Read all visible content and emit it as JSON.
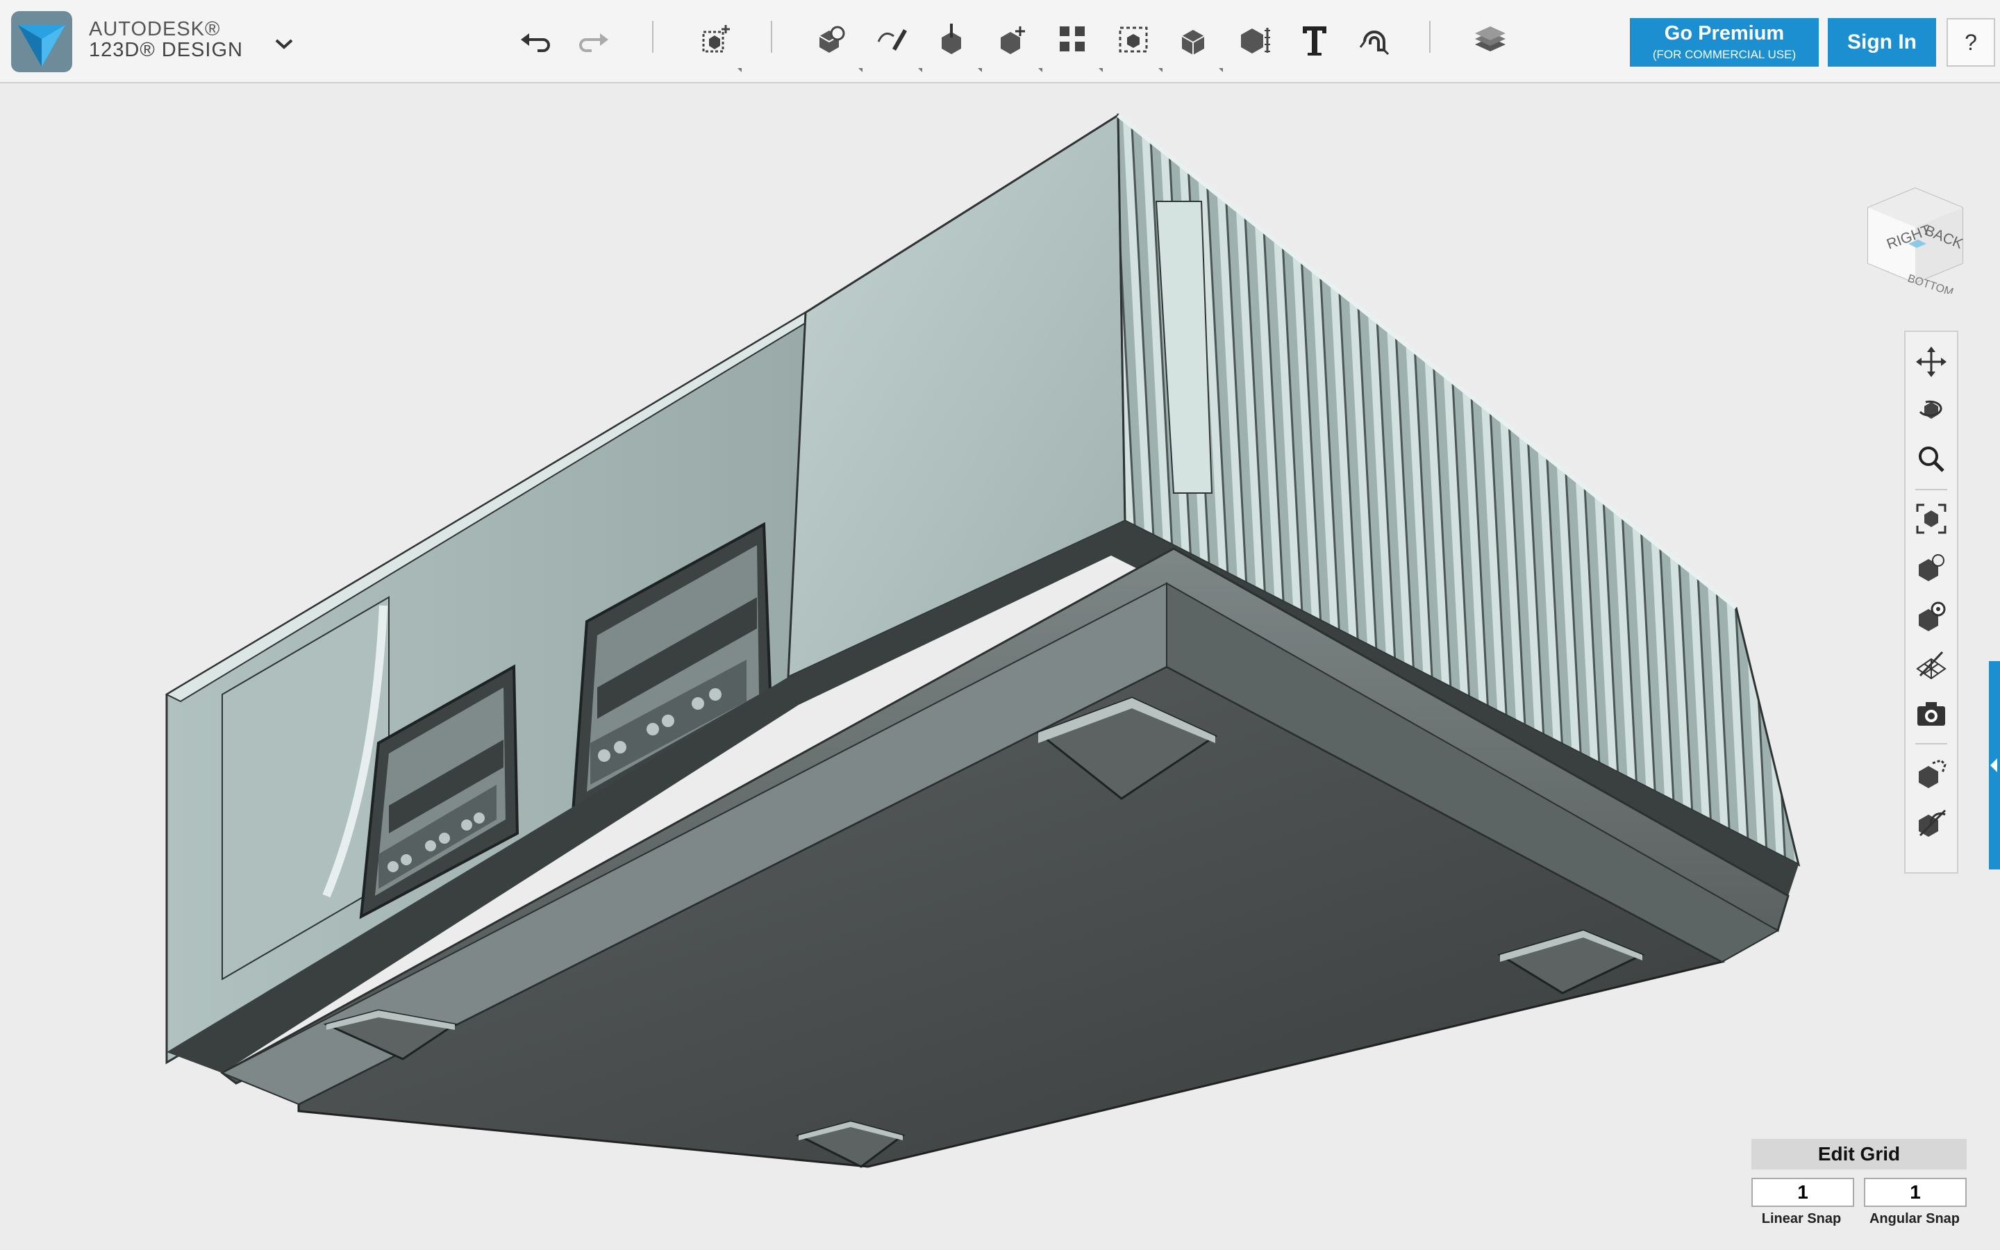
{
  "app": {
    "brand_top": "AUTODESK®",
    "brand_bottom": "123D® DESIGN"
  },
  "toolbar": {
    "tools": [
      {
        "name": "undo-icon"
      },
      {
        "name": "redo-icon"
      },
      {
        "name": "transform-icon"
      },
      {
        "name": "primitives-icon"
      },
      {
        "name": "sketch-icon"
      },
      {
        "name": "construct-icon"
      },
      {
        "name": "modify-icon"
      },
      {
        "name": "pattern-icon"
      },
      {
        "name": "grouping-icon"
      },
      {
        "name": "combine-icon"
      },
      {
        "name": "measure-icon"
      },
      {
        "name": "text-icon"
      },
      {
        "name": "snap-icon"
      },
      {
        "name": "material-icon"
      }
    ],
    "premium_label": "Go Premium",
    "premium_sub": "(FOR COMMERCIAL USE)",
    "signin_label": "Sign In",
    "help_label": "?"
  },
  "viewcube": {
    "faces": [
      "RIGHT",
      "BACK",
      "BOTTOM"
    ]
  },
  "nav_tools": [
    "pan-icon",
    "orbit-icon",
    "zoom-icon",
    "fit-icon",
    "perspective-icon",
    "visibility-icon",
    "grid-toggle-icon",
    "screenshot-icon",
    "material-mode-icon",
    "hide-icon"
  ],
  "grid_panel": {
    "edit_label": "Edit Grid",
    "linear_snap_value": "1",
    "angular_snap_value": "1",
    "linear_snap_label": "Linear Snap",
    "angular_snap_label": "Angular Snap"
  },
  "colors": {
    "accent": "#1b8fd0",
    "body_light": "#a8b8b8",
    "body_dark": "#3e4242"
  }
}
